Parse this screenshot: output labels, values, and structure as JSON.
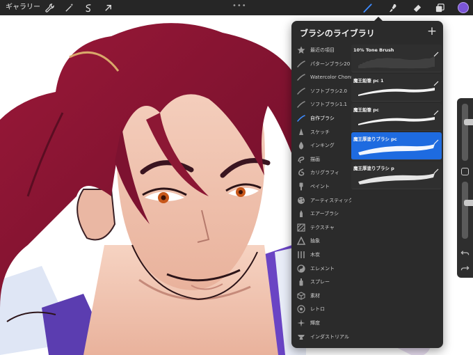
{
  "topbar": {
    "gallery_label": "ギャラリー",
    "handle": "•••",
    "tools": [
      "wrench-icon",
      "magic-wand-icon",
      "selection-icon",
      "transform-arrow-icon"
    ],
    "right_tools": [
      "brush-icon",
      "smudge-icon",
      "eraser-icon",
      "layers-icon"
    ],
    "current_color": "#7a55d6"
  },
  "brush_library": {
    "title": "ブラシのライブラリ",
    "add_label": "+",
    "brush_sets": [
      {
        "label": "最近の項目",
        "icon": "star-icon"
      },
      {
        "label": "パターンブラシ20",
        "icon": "stroke-icon"
      },
      {
        "label": "Watercolor Chonmang",
        "icon": "stroke-icon"
      },
      {
        "label": "ソフトブラシ2.0",
        "icon": "stroke-icon"
      },
      {
        "label": "ソフトブラシ1.1",
        "icon": "stroke-icon"
      },
      {
        "label": "自作ブラシ",
        "icon": "stroke-icon"
      },
      {
        "label": "スケッチ",
        "icon": "pencil-tip-icon"
      },
      {
        "label": "インキング",
        "icon": "ink-drop-icon"
      },
      {
        "label": "描画",
        "icon": "swirl-icon"
      },
      {
        "label": "カリグラフィ",
        "icon": "calligraphy-icon"
      },
      {
        "label": "ペイント",
        "icon": "paint-brush-icon"
      },
      {
        "label": "アーティスティック",
        "icon": "palette-icon"
      },
      {
        "label": "エアーブラシ",
        "icon": "airbrush-icon"
      },
      {
        "label": "テクスチャ",
        "icon": "texture-icon"
      },
      {
        "label": "抽象",
        "icon": "triangle-icon"
      },
      {
        "label": "木炭",
        "icon": "charcoal-icon"
      },
      {
        "label": "エレメント",
        "icon": "yin-yang-icon"
      },
      {
        "label": "スプレー",
        "icon": "spray-can-icon"
      },
      {
        "label": "素材",
        "icon": "cube-icon"
      },
      {
        "label": "レトロ",
        "icon": "retro-icon"
      },
      {
        "label": "輝度",
        "icon": "sparkle-icon"
      },
      {
        "label": "インダストリアル",
        "icon": "anvil-icon"
      }
    ],
    "active_set_index": 5,
    "brushes": [
      {
        "name": "10% Tone Brush",
        "style": "tone"
      },
      {
        "name": "魔王鉛筆 pc 1",
        "style": "pencil"
      },
      {
        "name": "魔王鉛筆 pc",
        "style": "pencil"
      },
      {
        "name": "魔王厚塗りブラシ pc",
        "style": "thick"
      },
      {
        "name": "魔王厚塗りブラシ p",
        "style": "thick"
      }
    ],
    "selected_brush_index": 3
  },
  "sidebar": {
    "brush_size_level": 0.3,
    "opacity_level": 0.35
  }
}
